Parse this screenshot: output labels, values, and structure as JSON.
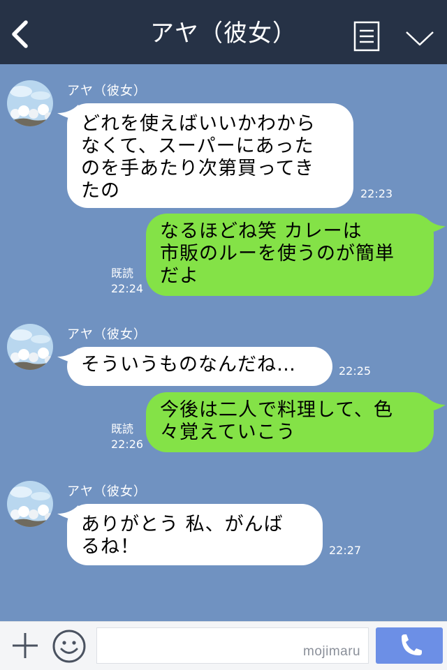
{
  "header": {
    "title": "アヤ（彼女）",
    "background": "#263246"
  },
  "chat": {
    "background": "#7092c1",
    "incoming_color": "#ffffff",
    "outgoing_color": "#84e247",
    "messages": [
      {
        "direction": "incoming",
        "sender": "アヤ（彼女）",
        "text": "どれを使えばいいかわから\nなくて、スーパーにあった\nのを手あたり次第買ってき\nたの",
        "time": "22:23"
      },
      {
        "direction": "outgoing",
        "text": "なるほどね笑 カレーは\n市販のルーを使うのが簡単\nだよ",
        "read_label": "既読",
        "time": "22:24"
      },
      {
        "direction": "incoming",
        "sender": "アヤ（彼女）",
        "text": "そういうものなんだね…",
        "time": "22:25"
      },
      {
        "direction": "outgoing",
        "text": "今後は二人で料理して、色\n々覚えていこう",
        "read_label": "既読",
        "time": "22:26"
      },
      {
        "direction": "incoming",
        "sender": "アヤ（彼女）",
        "text": "ありがとう 私、がんば\nるね！",
        "time": "22:27"
      }
    ]
  },
  "input": {
    "placeholder": "",
    "watermark": "mojimaru",
    "call_button_color": "#6c8fe6"
  },
  "icons": [
    "back-arrow-icon",
    "menu-list-icon",
    "chevron-down-icon",
    "plus-icon",
    "smiley-icon",
    "phone-icon"
  ]
}
